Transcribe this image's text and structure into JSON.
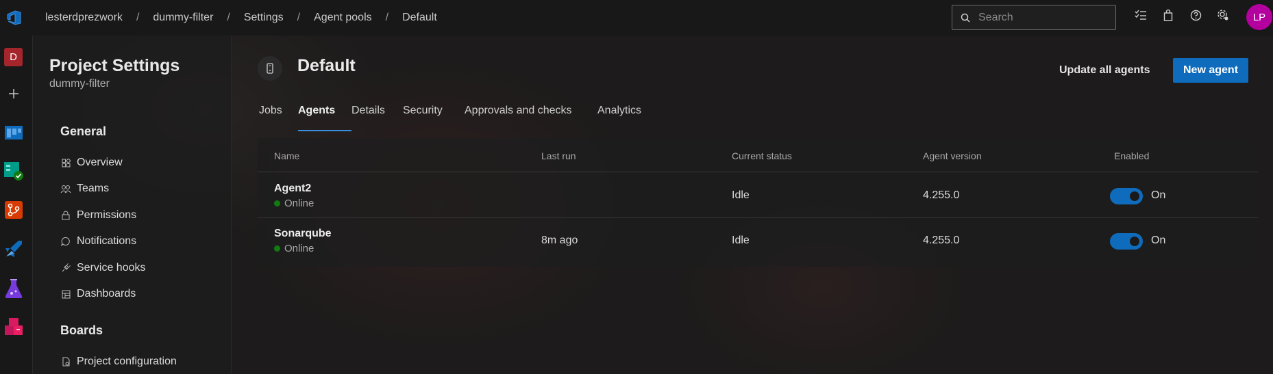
{
  "topbar": {
    "breadcrumb": [
      "lesterdprezwork",
      "dummy-filter",
      "Settings",
      "Agent pools",
      "Default"
    ],
    "separator": "/",
    "search_placeholder": "Search",
    "avatar_initials": "LP"
  },
  "rail": {
    "project_initial": "D"
  },
  "sidebar": {
    "title": "Project Settings",
    "subtitle": "dummy-filter",
    "sections": [
      {
        "label": "General",
        "items": [
          "Overview",
          "Teams",
          "Permissions",
          "Notifications",
          "Service hooks",
          "Dashboards"
        ]
      },
      {
        "label": "Boards",
        "items": [
          "Project configuration"
        ]
      }
    ]
  },
  "main": {
    "title": "Default",
    "update_button": "Update all agents",
    "new_button": "New agent",
    "tabs": [
      "Jobs",
      "Agents",
      "Details",
      "Security",
      "Approvals and checks",
      "Analytics"
    ],
    "active_tab": "Agents",
    "columns": [
      "Name",
      "Last run",
      "Current status",
      "Agent version",
      "Enabled"
    ],
    "rows": [
      {
        "name": "Agent2",
        "state": "Online",
        "last_run": "",
        "status": "Idle",
        "version": "4.255.0",
        "enabled": "On"
      },
      {
        "name": "Sonarqube",
        "state": "Online",
        "last_run": "8m ago",
        "status": "Idle",
        "version": "4.255.0",
        "enabled": "On"
      }
    ]
  },
  "colors": {
    "accent": "#0f6cbd",
    "online": "#107c10",
    "avatar": "#b4009e",
    "project": "#a4262c"
  }
}
